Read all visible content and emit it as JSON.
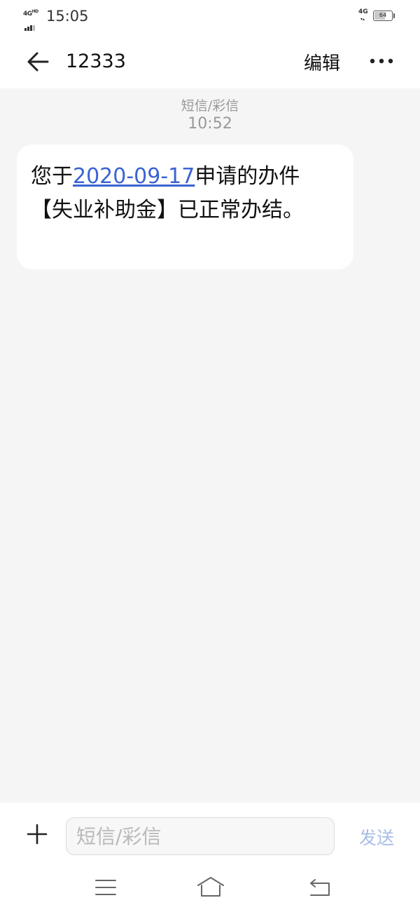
{
  "status_bar": {
    "time": "15:05",
    "signal_label": "4G",
    "signal_sup": "HD",
    "network_label": "4G",
    "network_arrows": "▾▴",
    "battery_level": "64",
    "battery_fraction": 0.64
  },
  "header": {
    "contact": "12333",
    "edit_label": "编辑",
    "back_icon": "arrow-left-icon",
    "more_icon": "more-horizontal-icon"
  },
  "conversation": {
    "message_type": "短信/彩信",
    "timestamp": "10:52",
    "message": {
      "text_before": "您于",
      "date_link": "2020-09-17",
      "text_after": "申请的办件【失业补助金】已正常办结。"
    }
  },
  "composer": {
    "placeholder": "短信/彩信",
    "value": "",
    "send_label": "发送",
    "plus_icon": "plus-icon"
  },
  "nav_bar": {
    "icons": [
      "menu-icon",
      "home-icon",
      "back-icon"
    ]
  },
  "colors": {
    "link": "#3b63d3",
    "send_disabled": "#a7bde6",
    "background": "#f5f5f5",
    "bubble": "#ffffff",
    "meta_text": "#999999"
  }
}
